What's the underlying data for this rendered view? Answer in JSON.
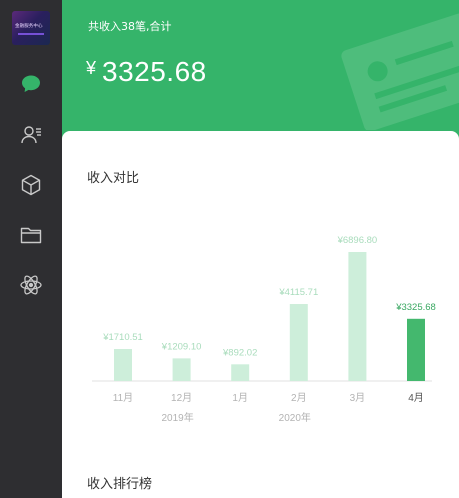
{
  "sidebar": {
    "logo_text": "金融服务中心",
    "items": [
      {
        "icon": "chat-icon",
        "active": true
      },
      {
        "icon": "user-list-icon",
        "active": false
      },
      {
        "icon": "cube-icon",
        "active": false
      },
      {
        "icon": "folder-icon",
        "active": false
      },
      {
        "icon": "atom-icon",
        "active": false
      }
    ]
  },
  "header": {
    "summary": "共收入38笔,合计",
    "currency": "¥",
    "total": "3325.68"
  },
  "card": {
    "title": "收入对比",
    "ranking_title": "收入排行榜"
  },
  "colors": {
    "brand_green": "#35b46a",
    "bar_light": "#cdeeda",
    "bar_active": "#44b86e",
    "sidebar_bg": "#2e2e31"
  },
  "chart_data": {
    "type": "bar",
    "categories": [
      "11月",
      "12月",
      "1月",
      "2月",
      "3月",
      "4月"
    ],
    "values": [
      1710.51,
      1209.1,
      892.02,
      4115.71,
      6896.8,
      3325.68
    ],
    "value_labels": [
      "¥1710.51",
      "¥1209.10",
      "¥892.02",
      "¥4115.71",
      "¥6896.80",
      "¥3325.68"
    ],
    "year_labels": [
      "",
      "2019年",
      "",
      "2020年",
      "",
      ""
    ],
    "active_index": 5,
    "ylim": [
      0,
      6896.8
    ],
    "grid": false
  }
}
